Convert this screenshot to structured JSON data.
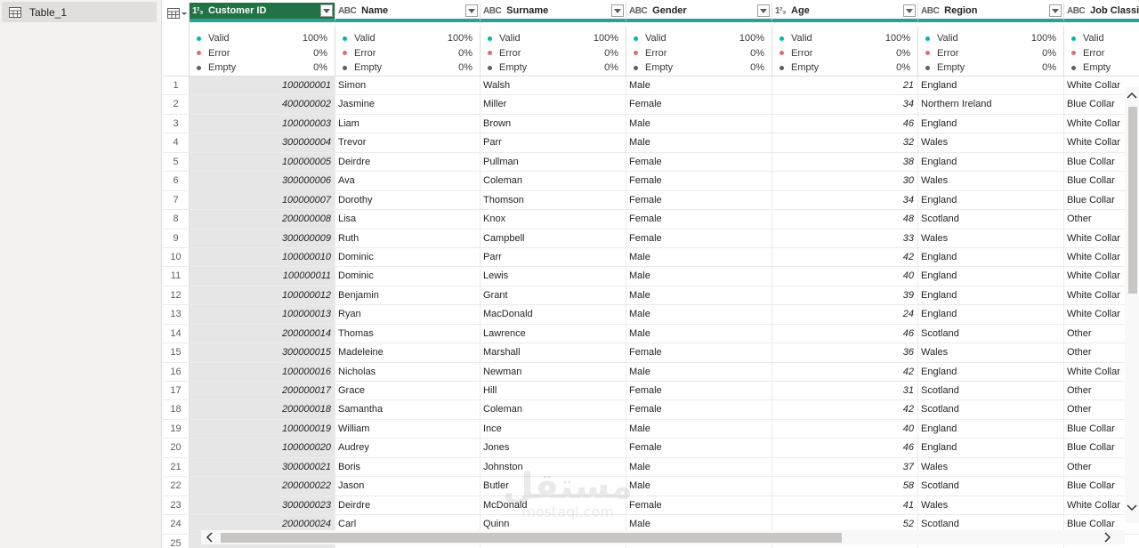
{
  "queries": {
    "items": [
      {
        "label": "Table_1"
      }
    ]
  },
  "columns": [
    {
      "key": "id",
      "title": "Customer ID",
      "type_icon": "1²₃",
      "selected": true,
      "numeric": true
    },
    {
      "key": "name",
      "title": "Name",
      "type_icon": "ABC",
      "selected": false,
      "numeric": false
    },
    {
      "key": "surname",
      "title": "Surname",
      "type_icon": "ABC",
      "selected": false,
      "numeric": false
    },
    {
      "key": "gender",
      "title": "Gender",
      "type_icon": "ABC",
      "selected": false,
      "numeric": false
    },
    {
      "key": "age",
      "title": "Age",
      "type_icon": "1²₃",
      "selected": false,
      "numeric": true
    },
    {
      "key": "region",
      "title": "Region",
      "type_icon": "ABC",
      "selected": false,
      "numeric": false
    },
    {
      "key": "job",
      "title": "Job Classifi",
      "type_icon": "ABC",
      "selected": false,
      "numeric": false
    }
  ],
  "column_quality": [
    {
      "label": "Valid",
      "value": "100%",
      "color": "#01b8aa"
    },
    {
      "label": "Error",
      "value": "0%",
      "color": "#e06c6c"
    },
    {
      "label": "Empty",
      "value": "0%",
      "color": "#605e5c"
    }
  ],
  "rows": [
    {
      "n": "1",
      "id": "100000001",
      "name": "Simon",
      "surname": "Walsh",
      "gender": "Male",
      "age": "21",
      "region": "England",
      "job": "White Collar"
    },
    {
      "n": "2",
      "id": "400000002",
      "name": "Jasmine",
      "surname": "Miller",
      "gender": "Female",
      "age": "34",
      "region": "Northern Ireland",
      "job": "Blue Collar"
    },
    {
      "n": "3",
      "id": "100000003",
      "name": "Liam",
      "surname": "Brown",
      "gender": "Male",
      "age": "46",
      "region": "England",
      "job": "White Collar"
    },
    {
      "n": "4",
      "id": "300000004",
      "name": "Trevor",
      "surname": "Parr",
      "gender": "Male",
      "age": "32",
      "region": "Wales",
      "job": "White Collar"
    },
    {
      "n": "5",
      "id": "100000005",
      "name": "Deirdre",
      "surname": "Pullman",
      "gender": "Female",
      "age": "38",
      "region": "England",
      "job": "Blue Collar"
    },
    {
      "n": "6",
      "id": "300000006",
      "name": "Ava",
      "surname": "Coleman",
      "gender": "Female",
      "age": "30",
      "region": "Wales",
      "job": "Blue Collar"
    },
    {
      "n": "7",
      "id": "100000007",
      "name": "Dorothy",
      "surname": "Thomson",
      "gender": "Female",
      "age": "34",
      "region": "England",
      "job": "Blue Collar"
    },
    {
      "n": "8",
      "id": "200000008",
      "name": "Lisa",
      "surname": "Knox",
      "gender": "Female",
      "age": "48",
      "region": "Scotland",
      "job": "Other"
    },
    {
      "n": "9",
      "id": "300000009",
      "name": "Ruth",
      "surname": "Campbell",
      "gender": "Female",
      "age": "33",
      "region": "Wales",
      "job": "White Collar"
    },
    {
      "n": "10",
      "id": "100000010",
      "name": "Dominic",
      "surname": "Parr",
      "gender": "Male",
      "age": "42",
      "region": "England",
      "job": "White Collar"
    },
    {
      "n": "11",
      "id": "100000011",
      "name": "Dominic",
      "surname": "Lewis",
      "gender": "Male",
      "age": "40",
      "region": "England",
      "job": "White Collar"
    },
    {
      "n": "12",
      "id": "100000012",
      "name": "Benjamin",
      "surname": "Grant",
      "gender": "Male",
      "age": "39",
      "region": "England",
      "job": "White Collar"
    },
    {
      "n": "13",
      "id": "100000013",
      "name": "Ryan",
      "surname": "MacDonald",
      "gender": "Male",
      "age": "24",
      "region": "England",
      "job": "White Collar"
    },
    {
      "n": "14",
      "id": "200000014",
      "name": "Thomas",
      "surname": "Lawrence",
      "gender": "Male",
      "age": "46",
      "region": "Scotland",
      "job": "Other"
    },
    {
      "n": "15",
      "id": "300000015",
      "name": "Madeleine",
      "surname": "Marshall",
      "gender": "Female",
      "age": "36",
      "region": "Wales",
      "job": "Other"
    },
    {
      "n": "16",
      "id": "100000016",
      "name": "Nicholas",
      "surname": "Newman",
      "gender": "Male",
      "age": "42",
      "region": "England",
      "job": "White Collar"
    },
    {
      "n": "17",
      "id": "200000017",
      "name": "Grace",
      "surname": "Hill",
      "gender": "Female",
      "age": "31",
      "region": "Scotland",
      "job": "Other"
    },
    {
      "n": "18",
      "id": "200000018",
      "name": "Samantha",
      "surname": "Coleman",
      "gender": "Female",
      "age": "42",
      "region": "Scotland",
      "job": "Other"
    },
    {
      "n": "19",
      "id": "100000019",
      "name": "William",
      "surname": "Ince",
      "gender": "Male",
      "age": "40",
      "region": "England",
      "job": "Blue Collar"
    },
    {
      "n": "20",
      "id": "100000020",
      "name": "Audrey",
      "surname": "Jones",
      "gender": "Female",
      "age": "46",
      "region": "England",
      "job": "Blue Collar"
    },
    {
      "n": "21",
      "id": "300000021",
      "name": "Boris",
      "surname": "Johnston",
      "gender": "Male",
      "age": "37",
      "region": "Wales",
      "job": "Other"
    },
    {
      "n": "22",
      "id": "200000022",
      "name": "Jason",
      "surname": "Butler",
      "gender": "Male",
      "age": "58",
      "region": "Scotland",
      "job": "Blue Collar"
    },
    {
      "n": "23",
      "id": "300000023",
      "name": "Deirdre",
      "surname": "McDonald",
      "gender": "Female",
      "age": "41",
      "region": "Wales",
      "job": "White Collar"
    },
    {
      "n": "24",
      "id": "200000024",
      "name": "Carl",
      "surname": "Quinn",
      "gender": "Male",
      "age": "52",
      "region": "Scotland",
      "job": "Blue Collar"
    },
    {
      "n": "25",
      "id": "",
      "name": "",
      "surname": "",
      "gender": "",
      "age": "",
      "region": "",
      "job": ""
    }
  ],
  "watermark": {
    "text": "مستقل",
    "sub": "mostaql.com"
  }
}
